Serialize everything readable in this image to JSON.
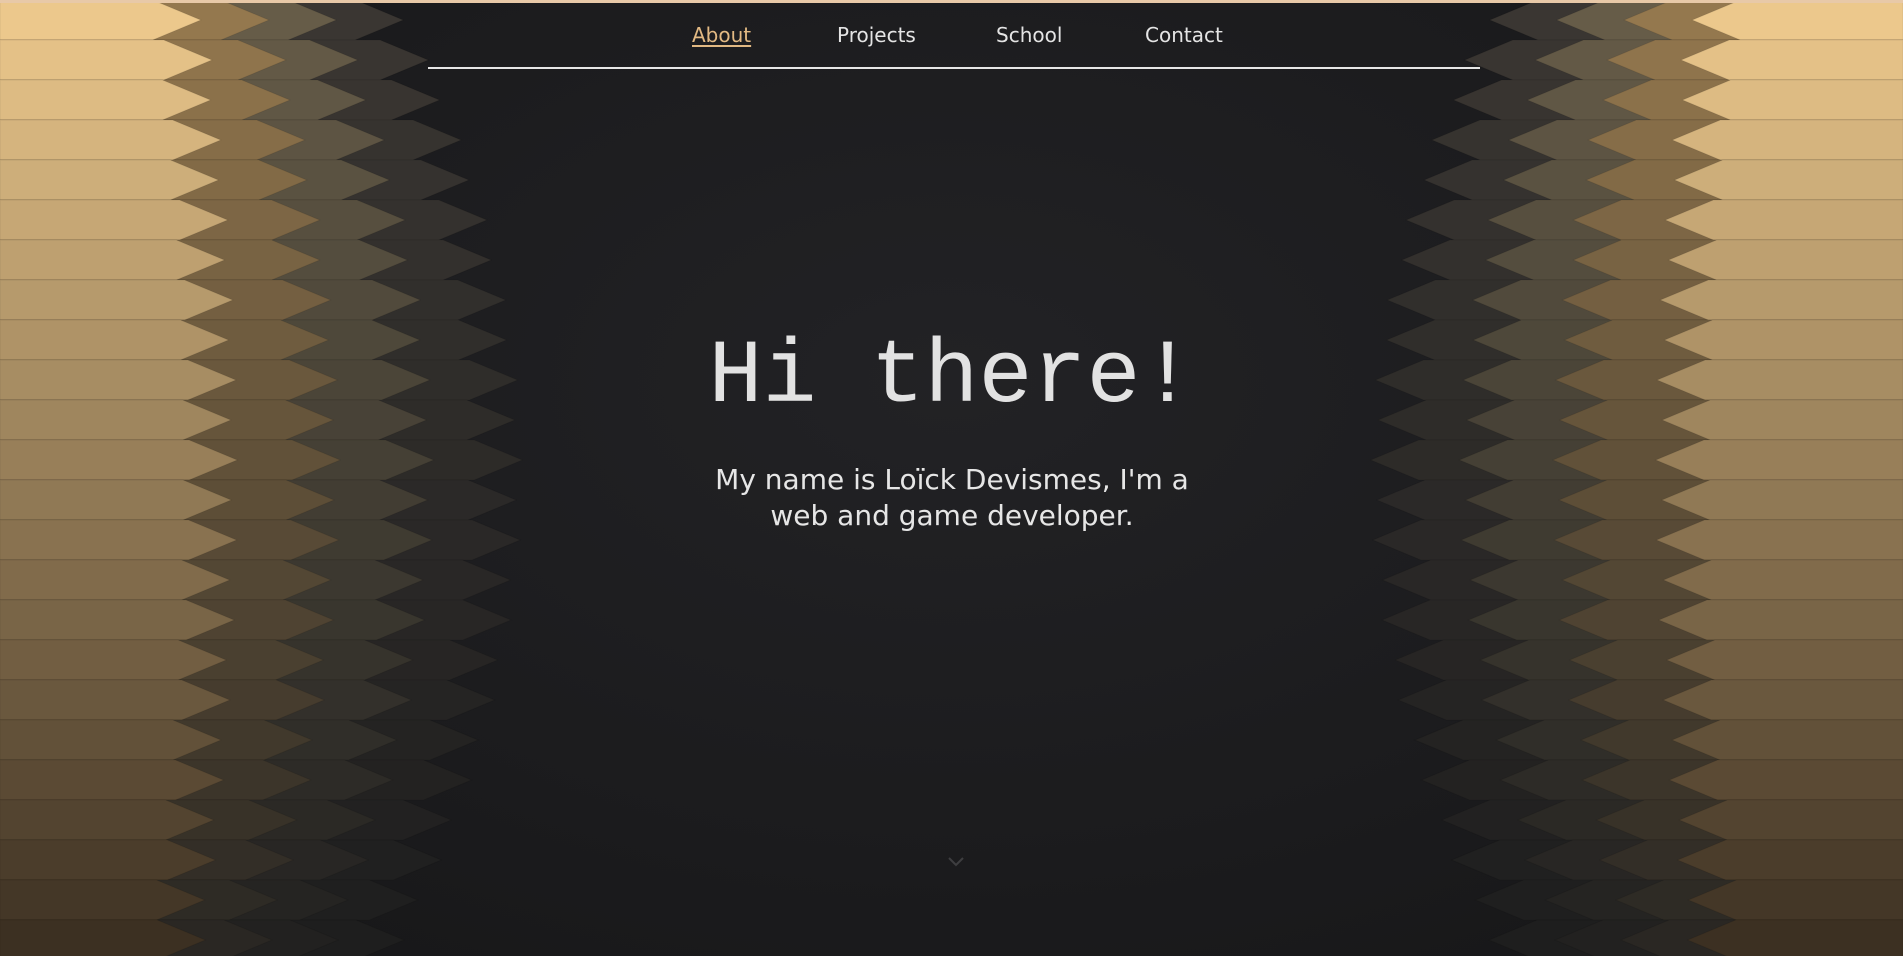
{
  "nav": {
    "items": [
      {
        "label": "About",
        "active": true
      },
      {
        "label": "Projects",
        "active": false
      },
      {
        "label": "School",
        "active": false
      },
      {
        "label": "Contact",
        "active": false
      }
    ]
  },
  "hero": {
    "title": "Hi there!",
    "subtitle": "My name is Loïck Devismes, I'm a web and game developer."
  },
  "icons": {
    "scroll_hint": "chevron-down-icon"
  },
  "colors": {
    "background": "#1c1c1e",
    "accent": "#e2b983",
    "text": "#e4e4e4",
    "gold_light": "#eccb94",
    "gold_dark": "#3b3022"
  }
}
